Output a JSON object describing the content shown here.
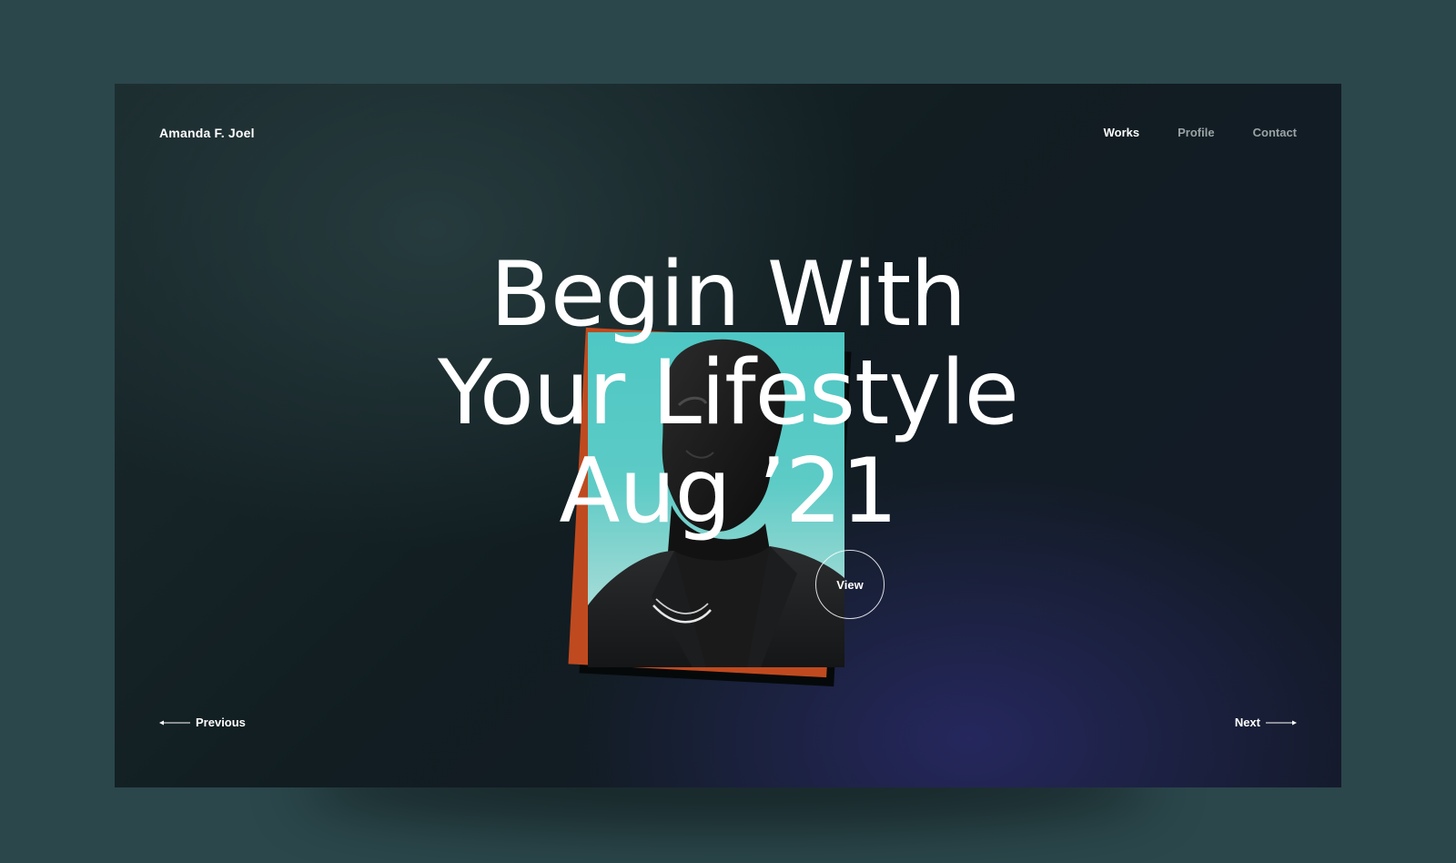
{
  "header": {
    "brand": "Amanda F. Joel",
    "nav": [
      {
        "label": "Works",
        "active": true
      },
      {
        "label": "Profile",
        "active": false
      },
      {
        "label": "Contact",
        "active": false
      }
    ]
  },
  "hero": {
    "title_lines": [
      "Begin With",
      "Your Lifestyle",
      "Aug ’21"
    ],
    "view_label": "View",
    "photo_alt": "Portrait of a man in a dark blazer against a teal sky"
  },
  "pagination": {
    "previous_label": "Previous",
    "next_label": "Next"
  },
  "colors": {
    "page_background": "#2b474b",
    "card_background": "#111d21",
    "accent_orange": "#c04a1f",
    "sky_teal": "#4ec7c4",
    "text": "#ffffff",
    "nav_inactive": "#9aa3a4"
  }
}
